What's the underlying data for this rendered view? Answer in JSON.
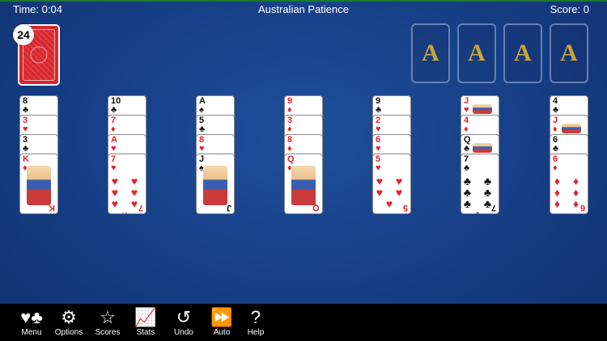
{
  "hud": {
    "time": "Time: 0:04",
    "title": "Australian Patience",
    "score": "Score: 0"
  },
  "stock": {
    "count": "24"
  },
  "foundations": [
    "A",
    "A",
    "A",
    "A"
  ],
  "tableau": [
    {
      "cards": [
        {
          "rank": "8",
          "suit": "♣",
          "color": "black"
        },
        {
          "rank": "3",
          "suit": "♥",
          "color": "red"
        },
        {
          "rank": "3",
          "suit": "♣",
          "color": "black"
        },
        {
          "rank": "K",
          "suit": "♦",
          "color": "red",
          "face": true
        }
      ]
    },
    {
      "cards": [
        {
          "rank": "10",
          "suit": "♣",
          "color": "black"
        },
        {
          "rank": "7",
          "suit": "♦",
          "color": "red"
        },
        {
          "rank": "A",
          "suit": "♥",
          "color": "red"
        },
        {
          "rank": "7",
          "suit": "♥",
          "color": "red",
          "pips": "♥ ♥ ♥ ♥ ♥ ♥ ♥"
        }
      ]
    },
    {
      "cards": [
        {
          "rank": "A",
          "suit": "♠",
          "color": "black"
        },
        {
          "rank": "5",
          "suit": "♣",
          "color": "black"
        },
        {
          "rank": "8",
          "suit": "♥",
          "color": "red"
        },
        {
          "rank": "J",
          "suit": "♠",
          "color": "black",
          "face": true
        }
      ]
    },
    {
      "cards": [
        {
          "rank": "9",
          "suit": "♦",
          "color": "red"
        },
        {
          "rank": "3",
          "suit": "♦",
          "color": "red"
        },
        {
          "rank": "8",
          "suit": "♦",
          "color": "red"
        },
        {
          "rank": "Q",
          "suit": "♦",
          "color": "red",
          "face": true
        }
      ]
    },
    {
      "cards": [
        {
          "rank": "9",
          "suit": "♣",
          "color": "black"
        },
        {
          "rank": "2",
          "suit": "♥",
          "color": "red"
        },
        {
          "rank": "6",
          "suit": "♥",
          "color": "red"
        },
        {
          "rank": "5",
          "suit": "♥",
          "color": "red",
          "pips": "♥ ♥ ♥ ♥ ♥"
        }
      ]
    },
    {
      "cards": [
        {
          "rank": "J",
          "suit": "♥",
          "color": "red",
          "face": true
        },
        {
          "rank": "4",
          "suit": "♦",
          "color": "red"
        },
        {
          "rank": "Q",
          "suit": "♣",
          "color": "black",
          "face": true
        },
        {
          "rank": "7",
          "suit": "♣",
          "color": "black",
          "pips": "♣ ♣ ♣ ♣ ♣ ♣ ♣"
        }
      ]
    },
    {
      "cards": [
        {
          "rank": "4",
          "suit": "♣",
          "color": "black"
        },
        {
          "rank": "J",
          "suit": "♦",
          "color": "red",
          "face": true
        },
        {
          "rank": "6",
          "suit": "♣",
          "color": "black"
        },
        {
          "rank": "6",
          "suit": "♦",
          "color": "red",
          "pips": "♦ ♦ ♦ ♦ ♦ ♦"
        }
      ]
    }
  ],
  "toolbar": [
    {
      "id": "menu",
      "label": "Menu",
      "icon": "♥♣"
    },
    {
      "id": "options",
      "label": "Options",
      "icon": "⚙"
    },
    {
      "id": "scores",
      "label": "Scores",
      "icon": "☆"
    },
    {
      "id": "stats",
      "label": "Stats",
      "icon": "📈"
    },
    {
      "id": "undo",
      "label": "Undo",
      "icon": "↺"
    },
    {
      "id": "auto",
      "label": "Auto",
      "icon": "⏩"
    },
    {
      "id": "help",
      "label": "Help",
      "icon": "?"
    }
  ]
}
